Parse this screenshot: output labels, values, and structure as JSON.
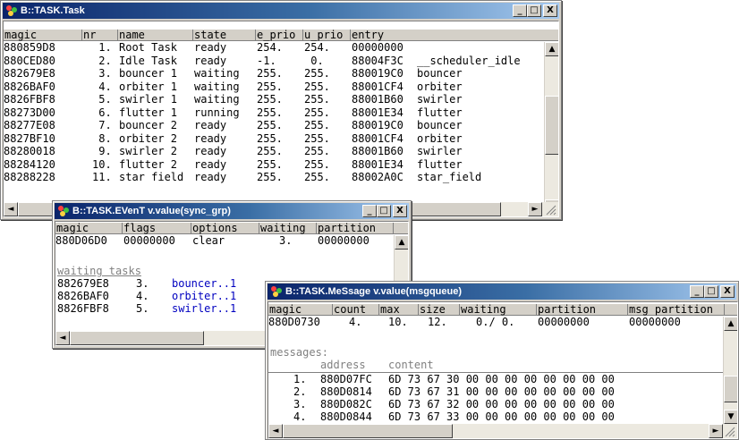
{
  "task_window": {
    "title": "B::TASK.Task",
    "headers": [
      "magic",
      "nr",
      "name",
      "state",
      "e_prio",
      "u_prio",
      "entry"
    ],
    "rows": [
      [
        "880859D8",
        " 1.",
        "Root Task",
        "ready",
        "254.",
        "254.",
        "00000000",
        ""
      ],
      [
        "880CED80",
        " 2.",
        "Idle Task",
        "ready",
        "-1.",
        " 0.",
        "88004F3C",
        "__scheduler_idle"
      ],
      [
        "882679E8",
        " 3.",
        "bouncer 1",
        "waiting",
        "255.",
        "255.",
        "880019C0",
        "bouncer"
      ],
      [
        "8826BAF0",
        " 4.",
        "orbiter 1",
        "waiting",
        "255.",
        "255.",
        "88001CF4",
        "orbiter"
      ],
      [
        "8826FBF8",
        " 5.",
        "swirler 1",
        "waiting",
        "255.",
        "255.",
        "88001B60",
        "swirler"
      ],
      [
        "88273D00",
        " 6.",
        "flutter 1",
        "running",
        "255.",
        "255.",
        "88001E34",
        "flutter"
      ],
      [
        "88277E08",
        " 7.",
        "bouncer 2",
        "ready",
        "255.",
        "255.",
        "880019C0",
        "bouncer"
      ],
      [
        "8827BF10",
        " 8.",
        "orbiter 2",
        "ready",
        "255.",
        "255.",
        "88001CF4",
        "orbiter"
      ],
      [
        "88280018",
        " 9.",
        "swirler 2",
        "ready",
        "255.",
        "255.",
        "88001B60",
        "swirler"
      ],
      [
        "88284120",
        "10.",
        "flutter 2",
        "ready",
        "255.",
        "255.",
        "88001E34",
        "flutter"
      ],
      [
        "88288228",
        "11.",
        "star field",
        "ready",
        "255.",
        "255.",
        "88002A0C",
        "star_field"
      ]
    ]
  },
  "event_window": {
    "title": "B::TASK.EVenT v.value(sync_grp)",
    "headers": [
      "magic",
      "flags",
      "options",
      "waiting",
      "partition"
    ],
    "row": [
      "880D06D0",
      "00000000",
      "clear",
      "3.",
      "00000000"
    ],
    "waiting_label": "waiting tasks",
    "waiting": [
      [
        "882679E8",
        "3.",
        "bouncer..1"
      ],
      [
        "8826BAF0",
        "4.",
        "orbiter..1"
      ],
      [
        "8826FBF8",
        "5.",
        "swirler..1"
      ]
    ]
  },
  "message_window": {
    "title": "B::TASK.MeSsage v.value(msgqueue)",
    "headers": [
      "magic",
      "count",
      "max",
      "size",
      "waiting",
      "partition",
      "msg partition"
    ],
    "row": [
      "880D0730",
      "4.",
      "10.",
      "12.",
      "0./ 0.",
      "00000000",
      "00000000"
    ],
    "messages_label": "messages:",
    "sub_headers": [
      "address",
      "content"
    ],
    "messages": [
      [
        "1.",
        "880D07FC",
        "6D 73 67 30 00 00 00 00 00 00 00 00"
      ],
      [
        "2.",
        "880D0814",
        "6D 73 67 31 00 00 00 00 00 00 00 00"
      ],
      [
        "3.",
        "880D082C",
        "6D 73 67 32 00 00 00 00 00 00 00 00"
      ],
      [
        "4.",
        "880D0844",
        "6D 73 67 33 00 00 00 00 00 00 00 00"
      ]
    ]
  },
  "buttons": {
    "minimize": "_",
    "maximize": "□",
    "close": "X"
  },
  "scroll_glyphs": {
    "up": "▲",
    "down": "▼",
    "left": "◄",
    "right": "►"
  },
  "colors": {
    "title_start": "#0a246a",
    "title_end": "#a6caf0",
    "frame": "#d4d0c8",
    "link_blue": "#0000c0"
  }
}
